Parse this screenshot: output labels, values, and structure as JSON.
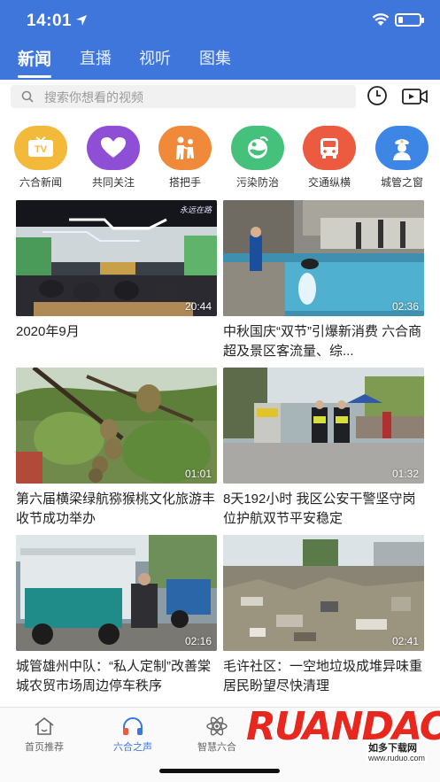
{
  "status_bar": {
    "time": "14:01"
  },
  "tabs": [
    {
      "label": "新闻",
      "active": true
    },
    {
      "label": "直播",
      "active": false
    },
    {
      "label": "视听",
      "active": false
    },
    {
      "label": "图集",
      "active": false
    }
  ],
  "search": {
    "placeholder": "搜索你想看的视频"
  },
  "channels": [
    {
      "label": "六合新闻",
      "icon": "tv-icon",
      "color": "#f2b93b"
    },
    {
      "label": "共同关注",
      "icon": "heart-icon",
      "color": "#8e4fd6"
    },
    {
      "label": "搭把手",
      "icon": "helping-hand-icon",
      "color": "#f08a3a"
    },
    {
      "label": "污染防治",
      "icon": "eco-globe-icon",
      "color": "#46c17c"
    },
    {
      "label": "交通纵横",
      "icon": "bus-icon",
      "color": "#ec5a3f"
    },
    {
      "label": "城管之窗",
      "icon": "officer-icon",
      "color": "#3e86e6"
    }
  ],
  "videos": [
    {
      "title": "2020年9月",
      "duration": "20:44",
      "overlay": "永远在路"
    },
    {
      "title": "中秋国庆“双节”引爆新消费 六合商超及景区客流量、综...",
      "duration": "02:36"
    },
    {
      "title": "第六届横梁绿航猕猴桃文化旅游丰收节成功举办",
      "duration": "01:01"
    },
    {
      "title": "8天192小时 我区公安干警坚守岗位护航双节平安稳定",
      "duration": "01:32"
    },
    {
      "title": "城管雄州中队：“私人定制”改善棠城农贸市场周边停车秩序",
      "duration": "02:16"
    },
    {
      "title": "毛许社区：一空地垃圾成堆异味重 居民盼望尽快清理",
      "duration": "02:41"
    }
  ],
  "bottom_nav": [
    {
      "label": "首页推荐",
      "icon": "home-icon",
      "active": false
    },
    {
      "label": "六合之声",
      "icon": "headphones-icon",
      "active": true
    },
    {
      "label": "智慧六合",
      "icon": "atom-icon",
      "active": false
    }
  ],
  "watermark": {
    "logo": "RUANDAO",
    "name": "如多下载网",
    "url": "www.ruduo.com"
  },
  "colors": {
    "brand": "#3e76db",
    "accent_text": "#3e76db"
  }
}
